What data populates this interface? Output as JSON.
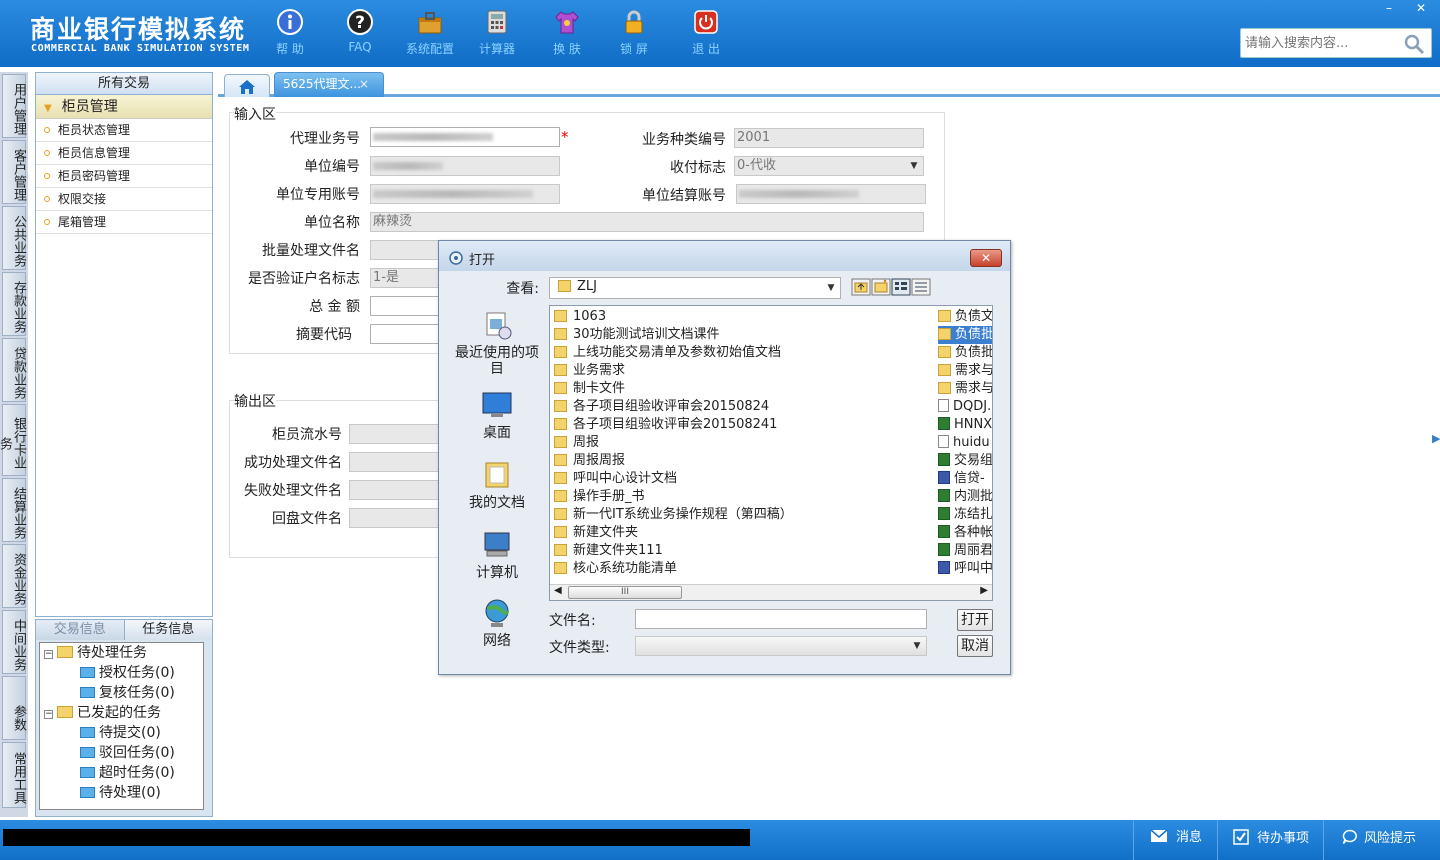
{
  "app": {
    "title_cn": "商业银行模拟系统",
    "title_en": "COMMERCIAL BANK SIMULATION SYSTEM",
    "brand_color": "#1677d2",
    "win_minimize": "–",
    "win_close": "✕"
  },
  "toolbar": [
    {
      "label": "帮 助",
      "icon": "info-icon"
    },
    {
      "label": "FAQ",
      "icon": "question-icon"
    },
    {
      "label": "系统配置",
      "icon": "toolbox-icon"
    },
    {
      "label": "计算器",
      "icon": "calculator-icon"
    },
    {
      "label": "换 肤",
      "icon": "tshirt-icon"
    },
    {
      "label": "锁 屏",
      "icon": "lock-icon"
    },
    {
      "label": "退 出",
      "icon": "power-icon"
    }
  ],
  "search": {
    "placeholder": "请输入搜索内容..."
  },
  "vtabs": [
    "用户管理",
    "客户管理",
    "公共业务",
    "存款业务",
    "贷款业务",
    "银行卡业务",
    "结算业务",
    "资金业务",
    "中间业务",
    "参数",
    "常用工具"
  ],
  "nav": {
    "header": "所有交易",
    "group": "柜员管理",
    "items": [
      "柜员状态管理",
      "柜员信息管理",
      "柜员密码管理",
      "权限交接",
      "尾箱管理"
    ]
  },
  "task": {
    "tabs": [
      "交易信息",
      "任务信息"
    ],
    "nodes": [
      {
        "label": "待处理任务"
      },
      {
        "label": "授权任务(0)"
      },
      {
        "label": "复核任务(0)"
      },
      {
        "label": "已发起的任务"
      },
      {
        "label": "待提交(0)"
      },
      {
        "label": "驳回任务(0)"
      },
      {
        "label": "超时任务(0)"
      },
      {
        "label": "待处理(0)"
      }
    ]
  },
  "tabs": {
    "doc_tab": "5625代理文...",
    "close": "×"
  },
  "input_section": {
    "title": "输入区",
    "labels": {
      "agent_no": "代理业务号",
      "biz_type_no": "业务种类编号",
      "unit_no": "单位编号",
      "pay_flag": "收付标志",
      "unit_account": "单位专用账号",
      "settle_account": "单位结算账号",
      "unit_name": "单位名称",
      "batch_file": "批量处理文件名",
      "verify_flag": "是否验证户名标志",
      "total_amount": "总 金 额",
      "summary_code": "摘要代码"
    },
    "values": {
      "biz_type_no": "2001",
      "pay_flag": "0-代收",
      "unit_name": "麻辣烫",
      "verify_flag": "1-是"
    },
    "required_mark": "*"
  },
  "output_section": {
    "title": "输出区",
    "labels": {
      "teller_serial": "柜员流水号",
      "success_file": "成功处理文件名",
      "fail_file": "失败处理文件名",
      "return_file": "回盘文件名"
    }
  },
  "dialog": {
    "title": "打开",
    "look_in_label": "查看:",
    "look_in_value": "ZLJ",
    "close": "✕",
    "places": [
      {
        "label": "最近使用的项目",
        "icon": "recent-items-icon"
      },
      {
        "label": "桌面",
        "icon": "desktop-icon"
      },
      {
        "label": "我的文档",
        "icon": "my-documents-icon"
      },
      {
        "label": "计算机",
        "icon": "computer-icon"
      },
      {
        "label": "网络",
        "icon": "network-icon"
      }
    ],
    "files_col1": [
      "1063",
      "30功能测试培训文档课件",
      "上线功能交易清单及参数初始值文档",
      "业务需求",
      "制卡文件",
      "各子项目组验收评审会20150824",
      "各子项目组验收评审会201508241",
      "周报",
      "周报周报",
      "呼叫中心设计文档",
      "操作手册_书",
      "新一代IT系统业务操作规程（第四稿）",
      "新建文件夹",
      "新建文件夹111",
      "核心系统功能清单"
    ],
    "files_col2": [
      {
        "name": "负债文",
        "type": "folder"
      },
      {
        "name": "负债批",
        "type": "folder"
      },
      {
        "name": "负债批",
        "type": "folder"
      },
      {
        "name": "需求与",
        "type": "folder"
      },
      {
        "name": "需求与",
        "type": "folder"
      },
      {
        "name": "DQDJ.",
        "type": "doc"
      },
      {
        "name": "HNNX_",
        "type": "excel"
      },
      {
        "name": "huidu",
        "type": "doc"
      },
      {
        "name": "交易组",
        "type": "excel"
      },
      {
        "name": "信贷-",
        "type": "word"
      },
      {
        "name": "内测批",
        "type": "excel"
      },
      {
        "name": "冻结扎",
        "type": "excel"
      },
      {
        "name": "各种帐",
        "type": "excel"
      },
      {
        "name": "周丽君",
        "type": "excel"
      },
      {
        "name": "呼叫中",
        "type": "word"
      }
    ],
    "filename_label": "文件名:",
    "filetype_label": "文件类型:",
    "open_button": "打开",
    "cancel_button": "取消",
    "scroll_grip": "III"
  },
  "statusbar": {
    "message": "消息",
    "todo": "待办事项",
    "risk": "风险提示"
  }
}
